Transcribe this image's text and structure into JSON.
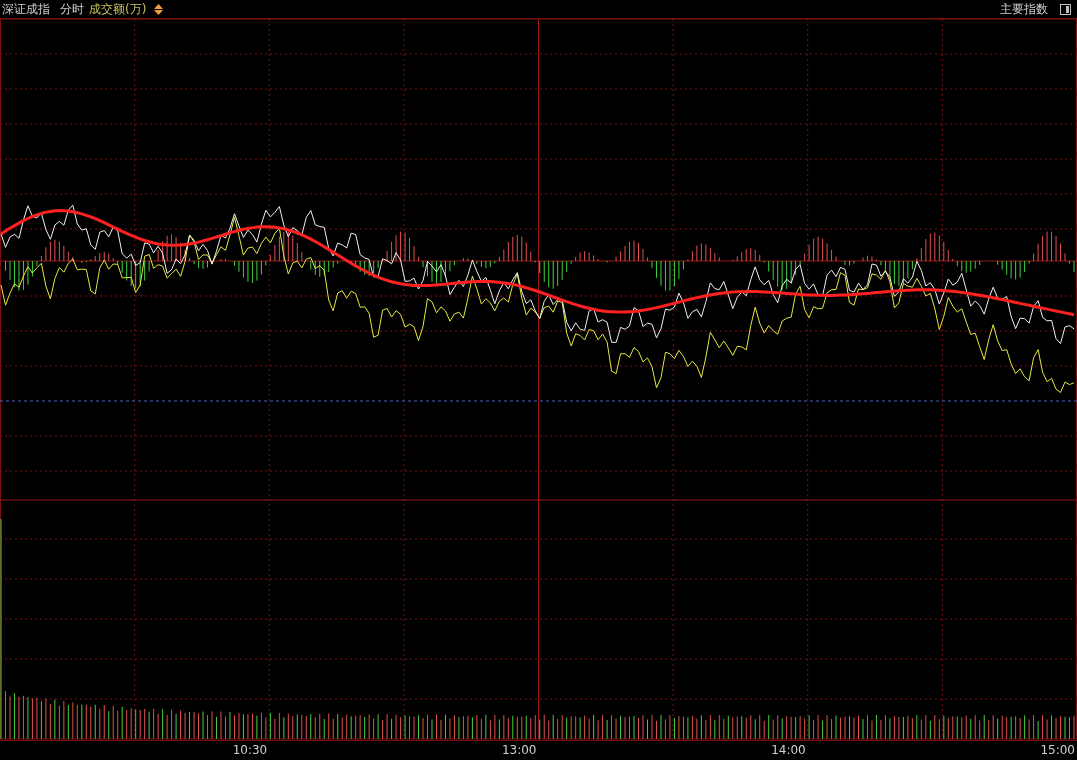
{
  "header": {
    "title": "深证成指",
    "period": "分时",
    "indicator": "成交额(万)",
    "right_label": "主要指数"
  },
  "time_axis": [
    {
      "label": "10:30"
    },
    {
      "label": "13:00"
    },
    {
      "label": "14:00"
    },
    {
      "label": "15:00"
    }
  ]
}
